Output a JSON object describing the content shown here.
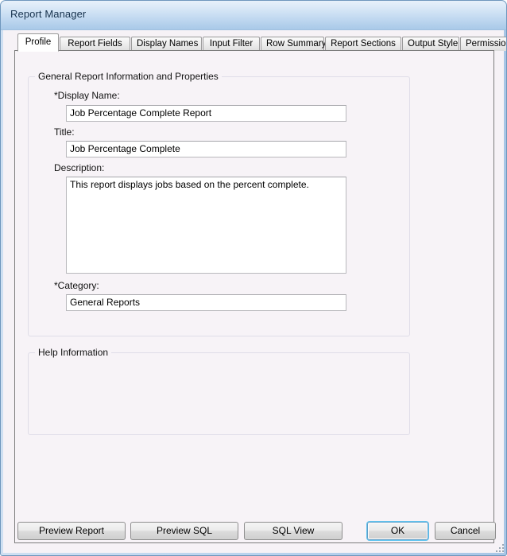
{
  "window": {
    "title": "Report Manager"
  },
  "tabs": [
    {
      "label": "Profile",
      "active": true
    },
    {
      "label": "Report Fields",
      "active": false
    },
    {
      "label": "Display Names",
      "active": false
    },
    {
      "label": "Input Filter",
      "active": false
    },
    {
      "label": "Row Summary",
      "active": false
    },
    {
      "label": "Report Sections",
      "active": false
    },
    {
      "label": "Output Style",
      "active": false
    },
    {
      "label": "Permissions",
      "active": false
    }
  ],
  "profile": {
    "general_group_title": "General Report Information and Properties",
    "display_name_label": "*Display Name:",
    "display_name_value": "Job Percentage Complete Report",
    "display_name_placeholder": "",
    "title_label": "Title:",
    "title_value": "Job Percentage Complete",
    "title_placeholder": "",
    "description_label": "Description:",
    "description_value": "This report displays jobs based on the percent complete.",
    "description_placeholder": "",
    "category_label": "*Category:",
    "category_value": "General Reports",
    "category_placeholder": "",
    "help_group_title": "Help Information",
    "help_value": ""
  },
  "footer": {
    "preview_report": "Preview Report",
    "preview_sql": "Preview SQL",
    "sql_view": "SQL View",
    "ok": "OK",
    "cancel": "Cancel"
  },
  "colors": {
    "titlebar_accent": "#a9c9e8",
    "window_border": "#6f97bd",
    "client_bg": "#f6f2f6",
    "panel_border": "#7c7c7c",
    "group_border": "#dfdde8",
    "default_button_glow": "#61c4ef"
  }
}
